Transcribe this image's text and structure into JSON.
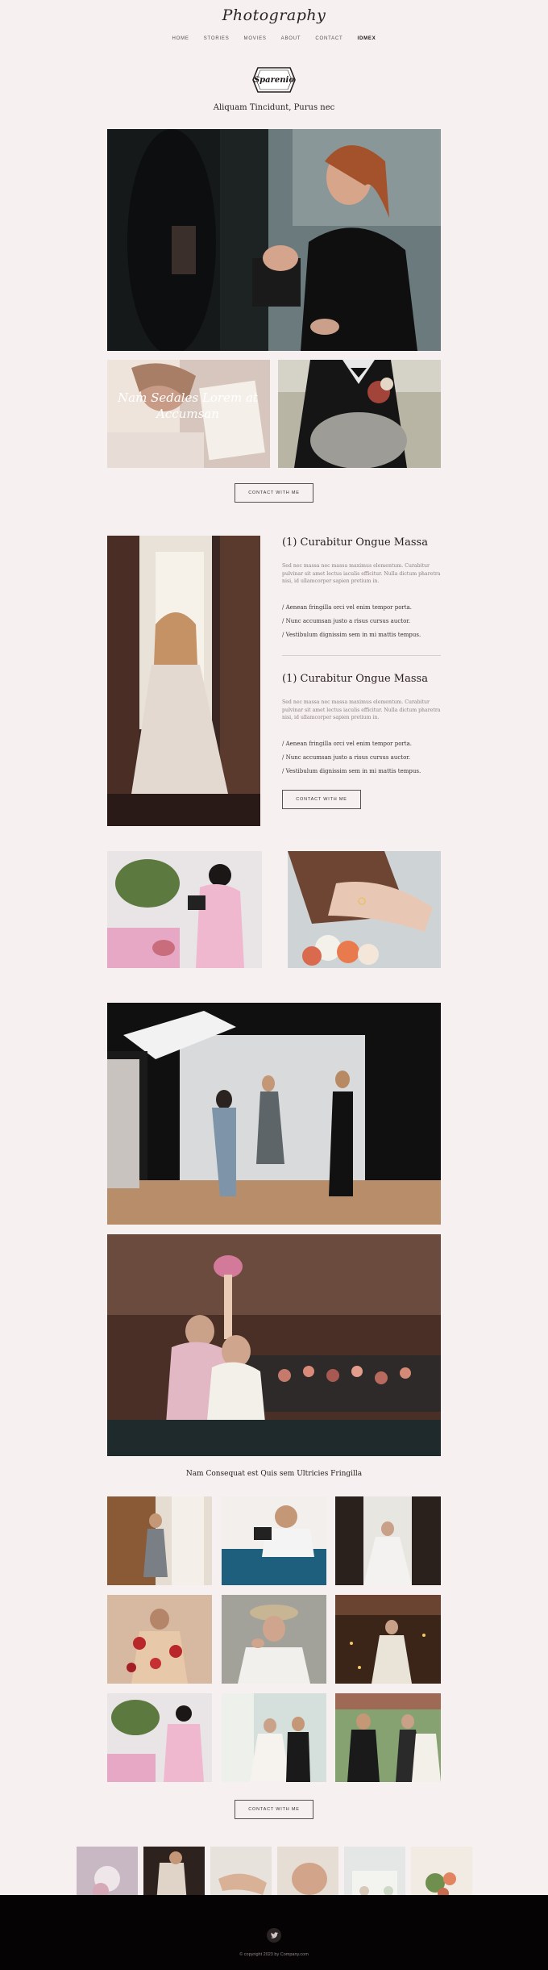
{
  "site": {
    "title": "Photography"
  },
  "nav": {
    "items": [
      {
        "label": "HOME",
        "active": false
      },
      {
        "label": "STORIES",
        "active": false
      },
      {
        "label": "MOVIES",
        "active": false
      },
      {
        "label": "ABOUT",
        "active": false
      },
      {
        "label": "CONTACT",
        "active": false
      },
      {
        "label": "IDMEX",
        "active": true
      }
    ]
  },
  "badge": {
    "name": "Sparenio"
  },
  "hero": {
    "subtitle": "Aliquam Tincidunt, Purus nec"
  },
  "overlay": {
    "text": "Nam Sedales Lorem at Accumsan"
  },
  "buttons": {
    "contact_1": "CONTACT WITH ME",
    "contact_2": "CONTACT WITH ME",
    "contact_3": "CONTACT WITH ME"
  },
  "sections": [
    {
      "heading": "(1) Curabitur Ongue Massa",
      "paragraph": "Sed nec massa nec massa maximus elementum. Curabitur pulvinar sit amet lectus iaculis efficitur. Nulla dictum pharetra nisi, id ullamcorper sapien pretium in.",
      "bullets": [
        "/ Aenean fringilla orci vel enim tempor porta.",
        "/ Nunc accumsan justo a risus cursus auctor.",
        "/ Vestibulum dignissim sem in mi mattis tempus."
      ]
    },
    {
      "heading": "(1) Curabitur Ongue Massa",
      "paragraph": "Sed nec massa nec massa maximus elementum. Curabitur pulvinar sit amet lectus iaculis efficitur. Nulla dictum pharetra nisi, id ullamcorper sapien pretium in.",
      "bullets": [
        "/ Aenean fringilla orci vel enim tempor porta.",
        "/ Nunc accumsan justo a risus cursus auctor.",
        "/ Vestibulum dignissim sem in mi mattis tempus."
      ]
    }
  ],
  "gallery": {
    "title": "Nam Consequat est Quis sem Ultricies Fringilla"
  },
  "footer": {
    "copyright": "© copyright 2023 by Company.com"
  },
  "colors": {
    "background": "#f6f1f0",
    "footer": "#050303",
    "text": "#2a2020"
  }
}
